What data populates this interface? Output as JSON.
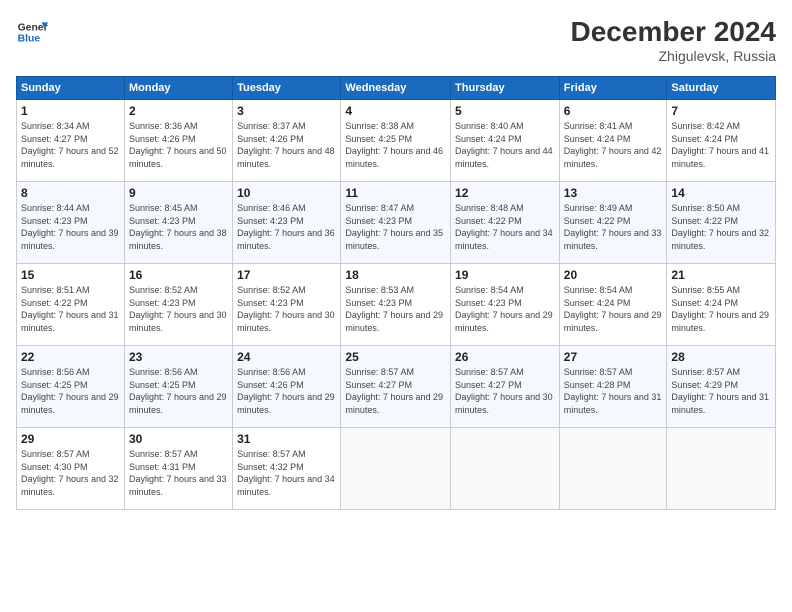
{
  "logo": {
    "line1": "General",
    "line2": "Blue"
  },
  "title": "December 2024",
  "subtitle": "Zhigulevsk, Russia",
  "days_header": [
    "Sunday",
    "Monday",
    "Tuesday",
    "Wednesday",
    "Thursday",
    "Friday",
    "Saturday"
  ],
  "weeks": [
    [
      {
        "day": "1",
        "sunrise": "8:34 AM",
        "sunset": "4:27 PM",
        "daylight": "7 hours and 52 minutes."
      },
      {
        "day": "2",
        "sunrise": "8:36 AM",
        "sunset": "4:26 PM",
        "daylight": "7 hours and 50 minutes."
      },
      {
        "day": "3",
        "sunrise": "8:37 AM",
        "sunset": "4:26 PM",
        "daylight": "7 hours and 48 minutes."
      },
      {
        "day": "4",
        "sunrise": "8:38 AM",
        "sunset": "4:25 PM",
        "daylight": "7 hours and 46 minutes."
      },
      {
        "day": "5",
        "sunrise": "8:40 AM",
        "sunset": "4:24 PM",
        "daylight": "7 hours and 44 minutes."
      },
      {
        "day": "6",
        "sunrise": "8:41 AM",
        "sunset": "4:24 PM",
        "daylight": "7 hours and 42 minutes."
      },
      {
        "day": "7",
        "sunrise": "8:42 AM",
        "sunset": "4:24 PM",
        "daylight": "7 hours and 41 minutes."
      }
    ],
    [
      {
        "day": "8",
        "sunrise": "8:44 AM",
        "sunset": "4:23 PM",
        "daylight": "7 hours and 39 minutes."
      },
      {
        "day": "9",
        "sunrise": "8:45 AM",
        "sunset": "4:23 PM",
        "daylight": "7 hours and 38 minutes."
      },
      {
        "day": "10",
        "sunrise": "8:46 AM",
        "sunset": "4:23 PM",
        "daylight": "7 hours and 36 minutes."
      },
      {
        "day": "11",
        "sunrise": "8:47 AM",
        "sunset": "4:23 PM",
        "daylight": "7 hours and 35 minutes."
      },
      {
        "day": "12",
        "sunrise": "8:48 AM",
        "sunset": "4:22 PM",
        "daylight": "7 hours and 34 minutes."
      },
      {
        "day": "13",
        "sunrise": "8:49 AM",
        "sunset": "4:22 PM",
        "daylight": "7 hours and 33 minutes."
      },
      {
        "day": "14",
        "sunrise": "8:50 AM",
        "sunset": "4:22 PM",
        "daylight": "7 hours and 32 minutes."
      }
    ],
    [
      {
        "day": "15",
        "sunrise": "8:51 AM",
        "sunset": "4:22 PM",
        "daylight": "7 hours and 31 minutes."
      },
      {
        "day": "16",
        "sunrise": "8:52 AM",
        "sunset": "4:23 PM",
        "daylight": "7 hours and 30 minutes."
      },
      {
        "day": "17",
        "sunrise": "8:52 AM",
        "sunset": "4:23 PM",
        "daylight": "7 hours and 30 minutes."
      },
      {
        "day": "18",
        "sunrise": "8:53 AM",
        "sunset": "4:23 PM",
        "daylight": "7 hours and 29 minutes."
      },
      {
        "day": "19",
        "sunrise": "8:54 AM",
        "sunset": "4:23 PM",
        "daylight": "7 hours and 29 minutes."
      },
      {
        "day": "20",
        "sunrise": "8:54 AM",
        "sunset": "4:24 PM",
        "daylight": "7 hours and 29 minutes."
      },
      {
        "day": "21",
        "sunrise": "8:55 AM",
        "sunset": "4:24 PM",
        "daylight": "7 hours and 29 minutes."
      }
    ],
    [
      {
        "day": "22",
        "sunrise": "8:56 AM",
        "sunset": "4:25 PM",
        "daylight": "7 hours and 29 minutes."
      },
      {
        "day": "23",
        "sunrise": "8:56 AM",
        "sunset": "4:25 PM",
        "daylight": "7 hours and 29 minutes."
      },
      {
        "day": "24",
        "sunrise": "8:56 AM",
        "sunset": "4:26 PM",
        "daylight": "7 hours and 29 minutes."
      },
      {
        "day": "25",
        "sunrise": "8:57 AM",
        "sunset": "4:27 PM",
        "daylight": "7 hours and 29 minutes."
      },
      {
        "day": "26",
        "sunrise": "8:57 AM",
        "sunset": "4:27 PM",
        "daylight": "7 hours and 30 minutes."
      },
      {
        "day": "27",
        "sunrise": "8:57 AM",
        "sunset": "4:28 PM",
        "daylight": "7 hours and 31 minutes."
      },
      {
        "day": "28",
        "sunrise": "8:57 AM",
        "sunset": "4:29 PM",
        "daylight": "7 hours and 31 minutes."
      }
    ],
    [
      {
        "day": "29",
        "sunrise": "8:57 AM",
        "sunset": "4:30 PM",
        "daylight": "7 hours and 32 minutes."
      },
      {
        "day": "30",
        "sunrise": "8:57 AM",
        "sunset": "4:31 PM",
        "daylight": "7 hours and 33 minutes."
      },
      {
        "day": "31",
        "sunrise": "8:57 AM",
        "sunset": "4:32 PM",
        "daylight": "7 hours and 34 minutes."
      },
      null,
      null,
      null,
      null
    ]
  ]
}
